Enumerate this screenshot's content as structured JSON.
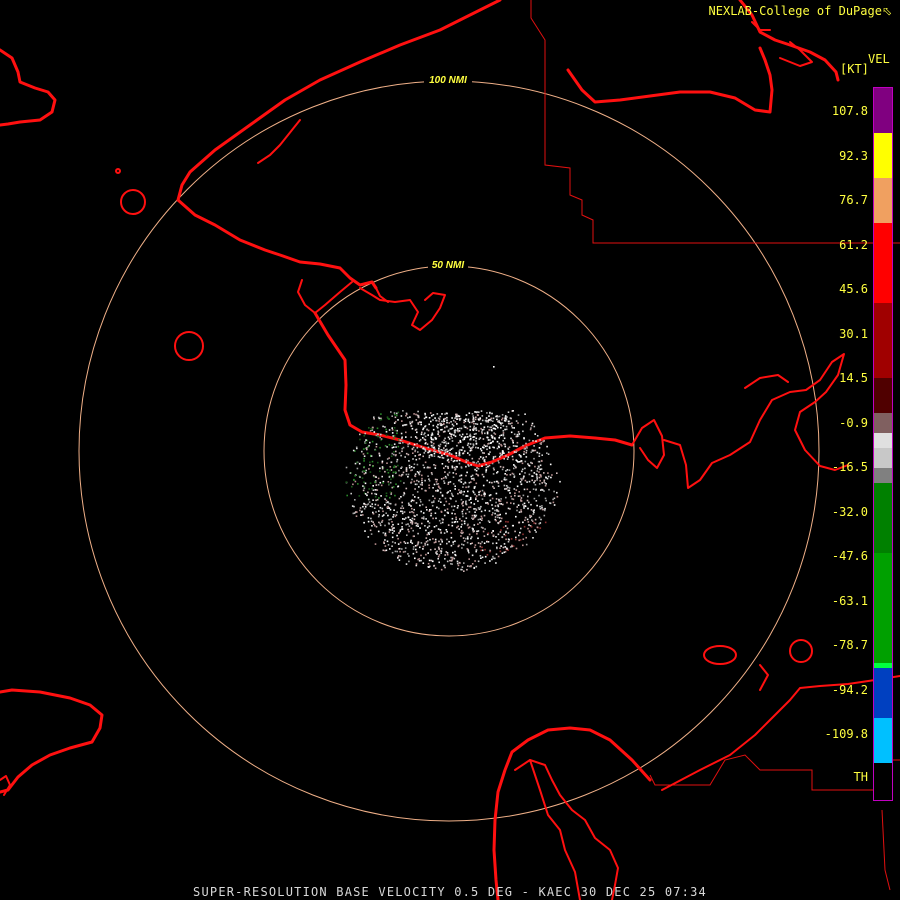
{
  "header": {
    "credit": "NEXLAB-College of DuPage",
    "credit_icon": "arrow-corner-icon"
  },
  "legend": {
    "title": "VEL",
    "unit": "[KT]",
    "ticks": [
      "107.8",
      "92.3",
      "76.7",
      "61.2",
      "45.6",
      "30.1",
      "14.5",
      "-0.9",
      "-16.5",
      "-32.0",
      "-47.6",
      "-63.1",
      "-78.7",
      "-94.2",
      "-109.8"
    ],
    "th_label": "TH",
    "colors": {
      "purple": "#800080",
      "yellow": "#ffff00",
      "orange": "#f0a060",
      "red": "#ff0000",
      "dark_red": "#500000",
      "gray": "#c8c8c8",
      "green": "#00a000",
      "bright_green": "#00ff40",
      "blue": "#0040c0",
      "cyan": "#00c0ff",
      "border": "#c000c0"
    }
  },
  "map": {
    "range_rings": [
      {
        "label": "100 NMI"
      },
      {
        "label": "50 NMI"
      }
    ],
    "ring_color": "#f0b088",
    "coast_color": "#ff1010",
    "border_color": "#e01010"
  },
  "footer": {
    "product": "SUPER-RESOLUTION BASE VELOCITY 0.5 DEG - KAEC 30 DEC 25 07:34"
  }
}
